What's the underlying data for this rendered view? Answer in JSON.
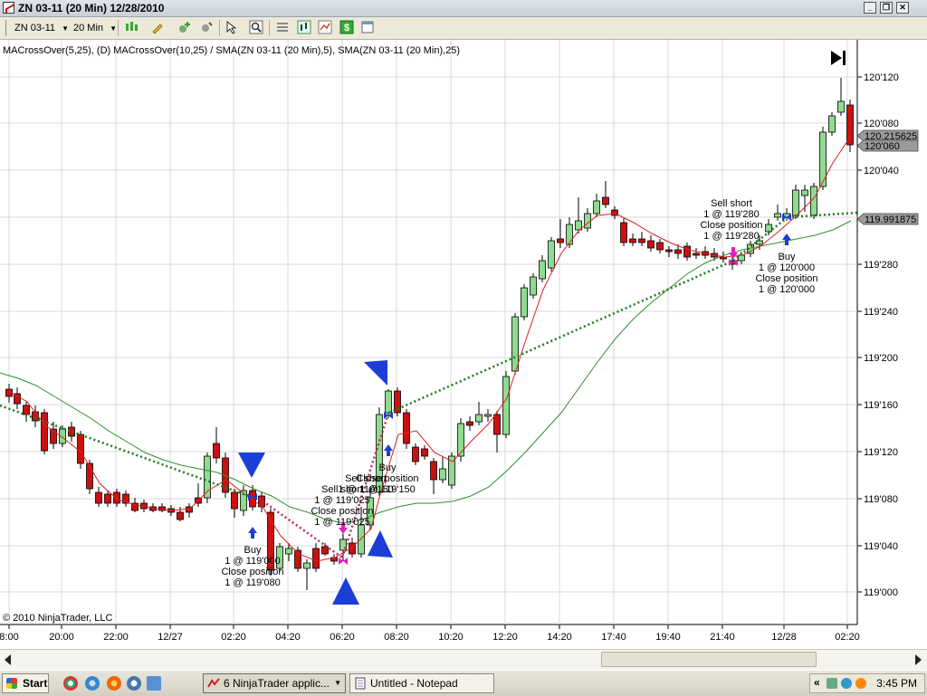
{
  "window": {
    "title": "ZN 03-11 (20 Min)  12/28/2010",
    "minimize_label": "_",
    "restore_label": "❐",
    "close_label": "✕"
  },
  "toolbar": {
    "instrument": "ZN 03-11",
    "interval": "20 Min"
  },
  "indicators_label": "MACrossOver(5,25), (D) MACrossOver(10,25) / SMA(ZN 03-11 (20 Min),5), SMA(ZN 03-11 (20 Min),25)",
  "copyright": "© 2010 NinjaTrader, LLC",
  "chart_data": {
    "type": "candlestick",
    "y_ticks": [
      "120'120",
      "120'080",
      "120'040",
      "119'280",
      "119'240",
      "119'200",
      "119'160",
      "119'120",
      "119'080",
      "119'040",
      "119'000"
    ],
    "x_ticks": [
      "8:00",
      "20:00",
      "22:00",
      "12/27",
      "02:20",
      "04:20",
      "06:20",
      "08:20",
      "10:20",
      "12:20",
      "14:20",
      "17:40",
      "19:40",
      "21:40",
      "12/28",
      "02:20"
    ],
    "price_tags": [
      "120.215625",
      "120'060",
      "119.991875"
    ],
    "series": [
      {
        "name": "SMA(ZN 03-11 (20 Min),5)",
        "color": "#e02020"
      },
      {
        "name": "SMA(ZN 03-11 (20 Min),25)",
        "color": "#2f8f2f"
      }
    ],
    "trade_labels": [
      {
        "lines": [
          "Buy",
          "1 @ 119'000",
          "Close position",
          "1 @ 119'080"
        ]
      },
      {
        "lines": [
          "Sell short",
          "1 @ 119'025",
          "Close position",
          "1 @ 119'025"
        ]
      },
      {
        "lines": [
          "Sell short",
          "1 @ 119'150"
        ]
      },
      {
        "lines": [
          "Buy",
          "Close position",
          "1 @ 119'150"
        ]
      },
      {
        "lines": [
          "Sell short",
          "1 @ 119'280",
          "Close position",
          "1 @ 119'280"
        ]
      },
      {
        "lines": [
          "Buy",
          "1 @ 120'000",
          "Close position",
          "1 @ 120'000"
        ]
      }
    ]
  },
  "taskbar": {
    "start_label": "Start",
    "task1_label": "6 NinjaTrader applic...",
    "task2_label": "Untitled - Notepad",
    "clock": "3:45 PM",
    "tray_chevron": "«"
  },
  "colors": {
    "up_candle": "#8fdc8f",
    "down_candle": "#cc1010",
    "accent_blue": "#1a3fd6",
    "accent_magenta": "#e020c0"
  }
}
